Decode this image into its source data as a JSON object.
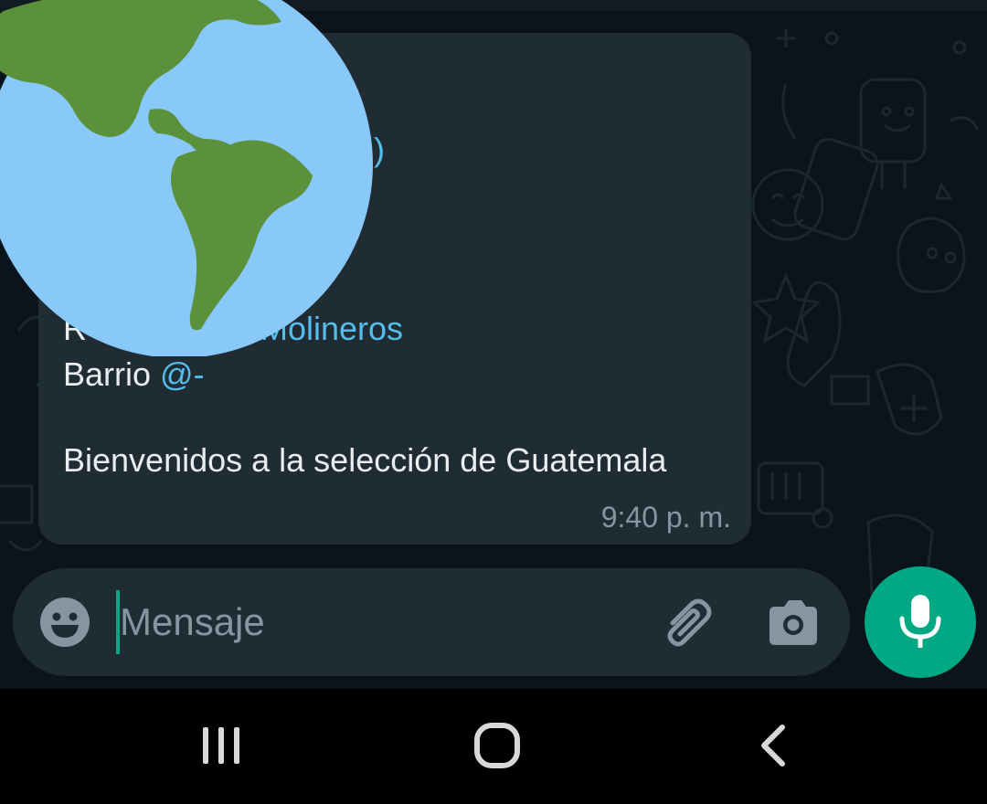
{
  "message": {
    "line1_partial": ":)",
    "line2_plain_partial": "R",
    "line2_mention": "Molineros",
    "line3_plain": "Barrio ",
    "line3_mention": "@-",
    "line4": "Bienvenidos a la selección de Guatemala",
    "time": "9:40 p. m."
  },
  "composer": {
    "placeholder": "Mensaje",
    "emoji_icon": "emoji-icon",
    "attach_icon": "paperclip-icon",
    "camera_icon": "camera-icon"
  },
  "mic_icon": "microphone-icon",
  "navbar": {
    "recents_icon": "recents-icon",
    "home_icon": "home-icon",
    "back_icon": "back-icon"
  },
  "overlay_icon": "globe-americas-icon",
  "colors": {
    "background": "#0b141a",
    "bubble": "#202c33",
    "accent": "#00a884",
    "mention": "#53bdeb",
    "text": "#e9edef",
    "muted": "#8696a0"
  }
}
